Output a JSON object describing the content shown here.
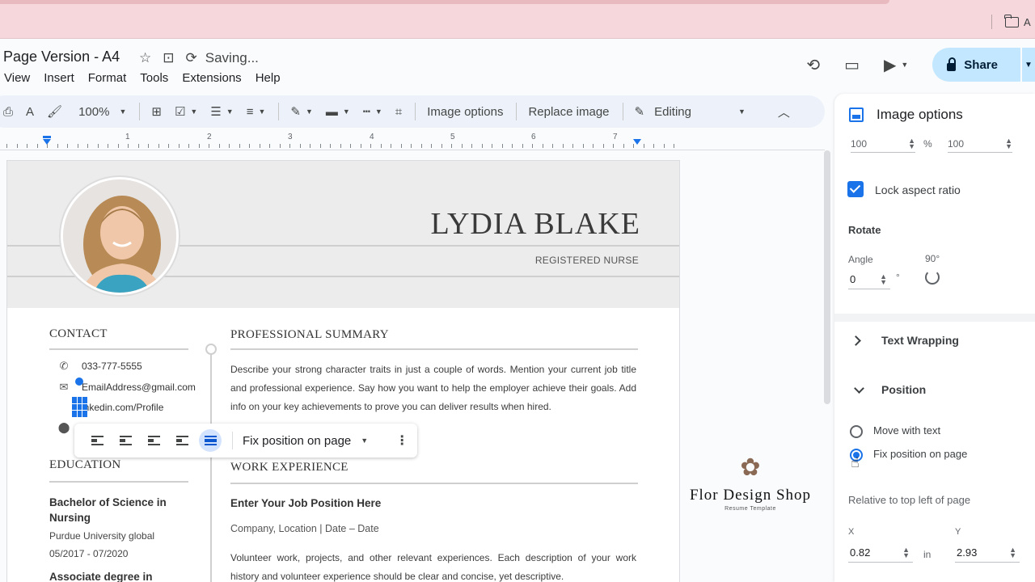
{
  "browser": {
    "bookmark_label": "A"
  },
  "header": {
    "doc_title": "Page Version - A4",
    "saving_status": "Saving...",
    "menus": [
      "View",
      "Insert",
      "Format",
      "Tools",
      "Extensions",
      "Help"
    ],
    "share_label": "Share"
  },
  "toolbar": {
    "zoom": "100%",
    "image_options": "Image options",
    "replace_image": "Replace image",
    "mode": "Editing"
  },
  "ruler": {
    "numbers": [
      "1",
      "2",
      "3",
      "4",
      "5",
      "6",
      "7"
    ]
  },
  "resume": {
    "name": "LYDIA BLAKE",
    "title": "REGISTERED NURSE",
    "contact_heading": "CONTACT",
    "phone": "033-777-5555",
    "email": "EmailAddress@gmail.com",
    "linkedin": "inkedin.com/Profile",
    "summary_heading": "PROFESSIONAL SUMMARY",
    "summary_text": "Describe your strong character traits in just a couple of words. Mention your current job title and professional experience. Say how you want to help the employer achieve their goals. Add info on your key achievements to prove you can deliver results when hired.",
    "education_heading": "EDUCATION",
    "degree": "Bachelor of Science in Nursing",
    "school": "Purdue University global",
    "dates": "05/2017 - 07/2020",
    "degree2": "Associate degree in",
    "work_heading": "WORK EXPERIENCE",
    "job_position": "Enter Your Job Position Here",
    "company_line": "Company, Location | Date – Date",
    "work_text": "Volunteer work, projects, and other relevant experiences. Each description of your work history and volunteer experience should be clear and concise, yet descriptive."
  },
  "image_toolbar": {
    "position_mode": "Fix position on page"
  },
  "watermark": {
    "name": "Flor Design Shop",
    "subtitle": "Resume Template"
  },
  "side_panel": {
    "title": "Image options",
    "width_value": "100",
    "percent": "%",
    "height_value": "100",
    "lock_aspect": "Lock aspect ratio",
    "rotate_heading": "Rotate",
    "angle_label": "Angle",
    "angle_90": "90°",
    "angle_value": "0",
    "degree_symbol": "°",
    "text_wrapping": "Text Wrapping",
    "position": "Position",
    "move_with_text": "Move with text",
    "fix_position": "Fix position on page",
    "relative_to": "Relative to top left of page",
    "x_label": "X",
    "y_label": "Y",
    "x_value": "0.82",
    "y_value": "2.93",
    "unit": "in"
  },
  "colors": {
    "accent": "#1a73e8",
    "share_bg": "#c2e7ff",
    "browser_bar": "#f6d7db"
  }
}
